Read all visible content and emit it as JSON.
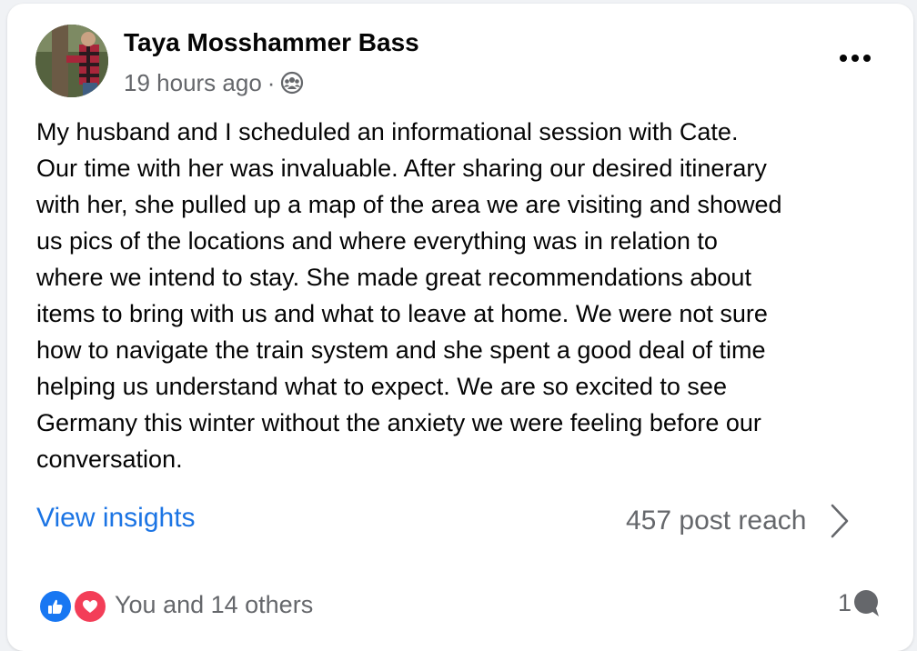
{
  "post": {
    "author": "Taya Mosshammer Bass",
    "timestamp": "19 hours ago",
    "separator": "·",
    "audience_icon": "friends-icon",
    "more_icon": "more-horizontal-icon",
    "body_lines": [
      "My husband and I scheduled an informational session with Cate.",
      "Our time with her was invaluable. After sharing our desired itinerary",
      "with her, she pulled up a map of the area we are visiting and showed",
      "us pics of the locations and where everything was in relation to",
      "where we intend to stay. She made great recommendations about",
      "items to bring with us and what to leave at home. We were not sure",
      "how to navigate the train system and she spent a good deal of time",
      "helping us understand what to expect. We are so excited to see",
      "Germany this winter without the anxiety we were feeling before our",
      "conversation."
    ]
  },
  "insights": {
    "link_label": "View insights",
    "reach_label": "457 post reach"
  },
  "footer": {
    "reactions_text": "You and 14 others",
    "reaction_icons": [
      "like-icon",
      "love-icon"
    ],
    "comment_count": "1",
    "comment_icon": "comment-bubble-icon"
  },
  "colors": {
    "link_blue": "#1b74e4",
    "like_blue": "#1877f2",
    "love_red": "#f33e58",
    "secondary_text": "#65676b"
  }
}
